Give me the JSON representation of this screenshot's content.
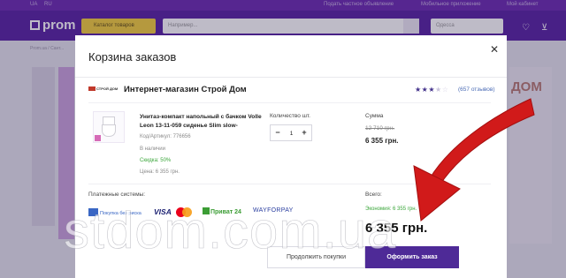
{
  "site": {
    "lang_ua": "UA",
    "lang_ru": "RU",
    "top_links": [
      "Подать частное объявление",
      "Мобильное приложение",
      "Мой кабинет"
    ],
    "logo": "prom",
    "catalog_button": "Каталог товаров",
    "search_placeholder": "Например...",
    "region_placeholder": "Одесса",
    "breadcrumb": "Prom.ua / Сант..."
  },
  "modal": {
    "title": "Корзина заказов",
    "close_icon": "close-icon",
    "store": {
      "logo_text": "СТРОЙ ДОМ",
      "name": "Интернет-магазин Строй Дом",
      "rating_stars": "4.5",
      "reviews": "(657 отзывов)"
    },
    "item": {
      "name": "Унитаз-компакт напольный с бачком Volle Leon 13-11-059 сиденье Slim slow-",
      "sku": "Код/Артикул: 776656",
      "availability": "В наличии",
      "discount": "Скидка: 50%",
      "price": "Цена: 6 355 грн.",
      "quantity_label": "Количество шт.",
      "quantity": "1",
      "sum_label": "Сумма",
      "sum_old": "12 710 грн.",
      "sum_new": "6 355 грн."
    },
    "payment": {
      "label": "Платежные системы:",
      "safe_pay": "Покупка без риска",
      "visa": "VISA",
      "privat": "Приват 24",
      "wayforpay": "WAYFORPAY"
    },
    "totals": {
      "label": "Всего:",
      "saving": "Экономия: 6 355 грн.",
      "total": "6 355 грн."
    },
    "buttons": {
      "continue": "Продолжить покупки",
      "checkout": "Оформить заказ"
    }
  },
  "annotation": {
    "arrow_color": "#d11a1a",
    "watermark": "stdom.com.ua"
  },
  "colors": {
    "brand_header": "#5722a3",
    "checkout_button": "#4e2a97",
    "discount_green": "#3aa63a",
    "link_blue": "#4a6bb5"
  }
}
